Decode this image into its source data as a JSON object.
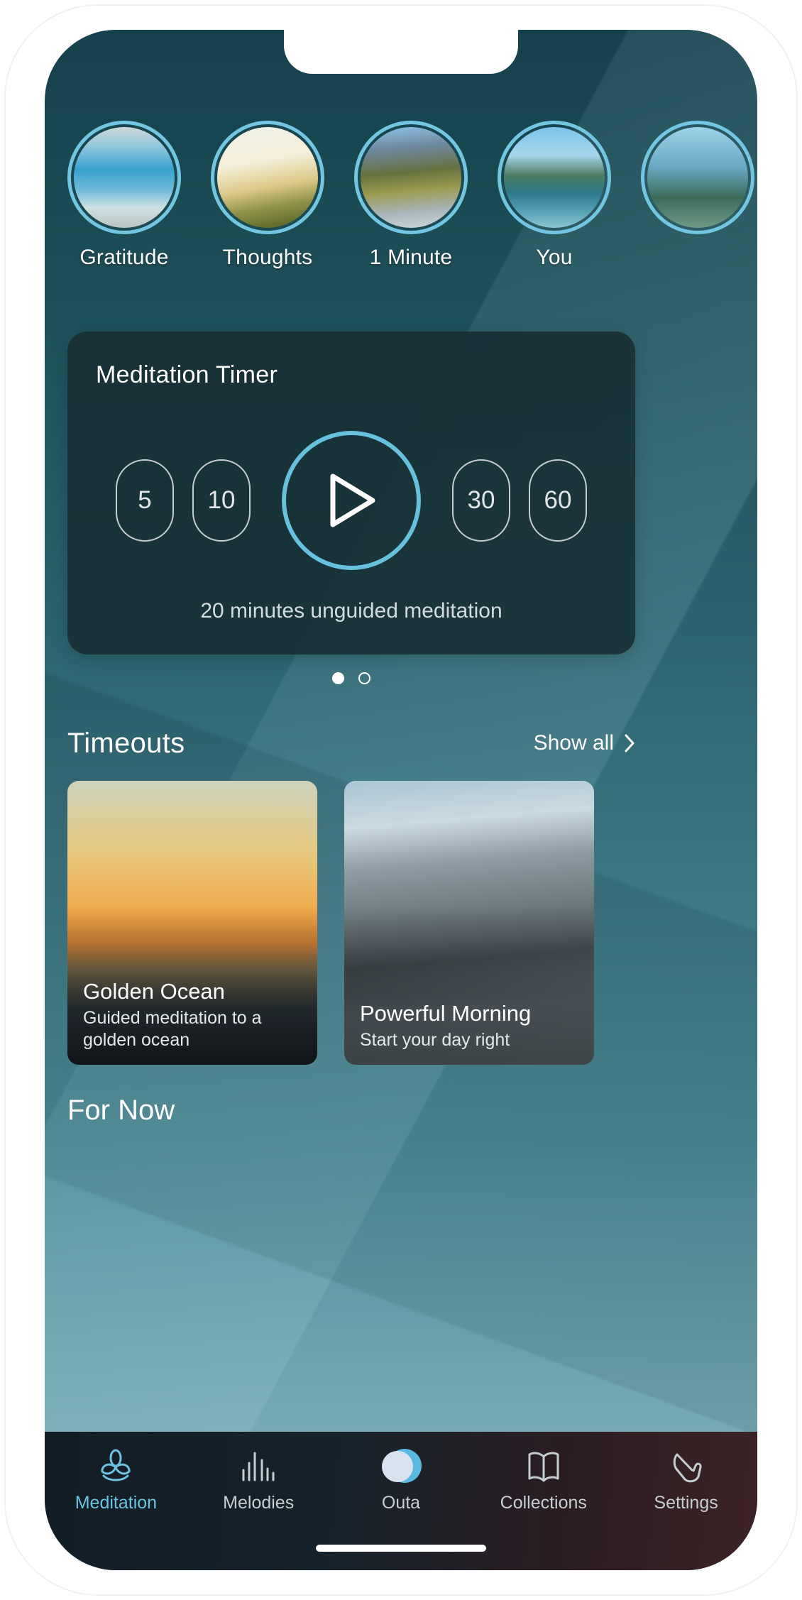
{
  "app": {
    "background_top": "#15414c",
    "background_bottom": "#86b2bb",
    "accent": "#6cc2e0"
  },
  "stories": {
    "items": [
      {
        "label": "Gratitude",
        "image": "stacked-stones-ocean"
      },
      {
        "label": "Thoughts",
        "image": "sunlit-meadow"
      },
      {
        "label": "1 Minute",
        "image": "mountain-river"
      },
      {
        "label": "You",
        "image": "calm-lake"
      },
      {
        "label": "",
        "image": "partial-next-story"
      }
    ]
  },
  "timer": {
    "title": "Meditation Timer",
    "durations": [
      "5",
      "10",
      "30",
      "60"
    ],
    "play_label": "play",
    "subtitle": "20 minutes unguided meditation",
    "ring_color": "#67c1dd"
  },
  "pagination": {
    "total": 2,
    "active_index": 0
  },
  "timeouts": {
    "title": "Timeouts",
    "show_all_label": "Show all",
    "cards": [
      {
        "title": "Golden Ocean",
        "subtitle": "Guided meditation to a golden ocean",
        "image": "golden-sunset-over-ocean"
      },
      {
        "title": "Powerful Morning",
        "subtitle": "Start your day right",
        "image": "coastal-rocks-blue-water"
      }
    ]
  },
  "for_now": {
    "title": "For Now"
  },
  "bottom_nav": {
    "items": [
      {
        "label": "Meditation",
        "icon": "lotus-icon",
        "active": true
      },
      {
        "label": "Melodies",
        "icon": "equalizer-icon",
        "active": false
      },
      {
        "label": "Outa",
        "icon": "outa-blob-icon",
        "active": false
      },
      {
        "label": "Collections",
        "icon": "book-icon",
        "active": false
      },
      {
        "label": "Settings",
        "icon": "hand-gesture-icon",
        "active": false
      }
    ]
  }
}
